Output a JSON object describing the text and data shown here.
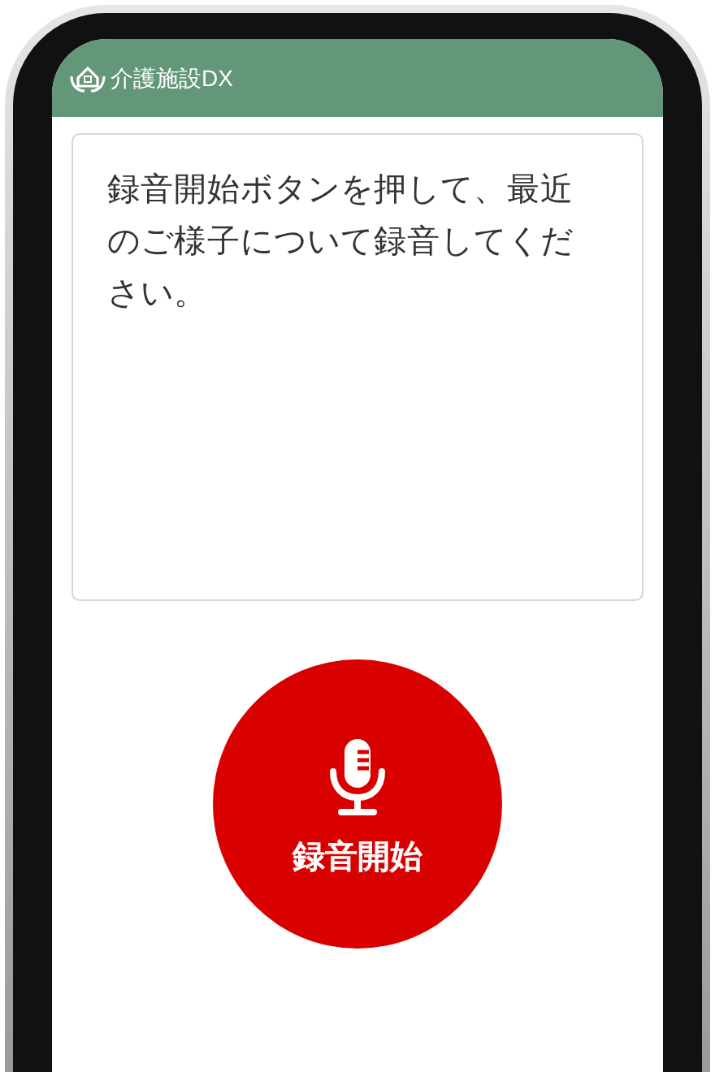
{
  "header": {
    "title": "介護施設DX"
  },
  "prompt": {
    "text": "録音開始ボタンを押して、最近のご様子について録音してください。"
  },
  "record_button": {
    "label": "録音開始"
  }
}
